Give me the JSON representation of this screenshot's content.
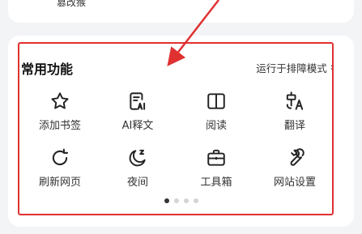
{
  "top": {
    "label": "篡改猴"
  },
  "section": {
    "title": "常用功能",
    "mode_link": "运行于排障模式",
    "mode_chevron": "›"
  },
  "functions": [
    {
      "label": "添加书签",
      "icon": "star-icon"
    },
    {
      "label": "AI释文",
      "icon": "ai-document-icon"
    },
    {
      "label": "阅读",
      "icon": "book-icon"
    },
    {
      "label": "翻译",
      "icon": "translate-icon"
    },
    {
      "label": "刷新网页",
      "icon": "refresh-icon"
    },
    {
      "label": "夜间",
      "icon": "moon-icon"
    },
    {
      "label": "工具箱",
      "icon": "toolbox-icon"
    },
    {
      "label": "网站设置",
      "icon": "wrench-icon"
    }
  ],
  "pager": {
    "pages": 4,
    "active": 1
  },
  "colors": {
    "annotation": "#e03131",
    "icon": "#222222"
  }
}
